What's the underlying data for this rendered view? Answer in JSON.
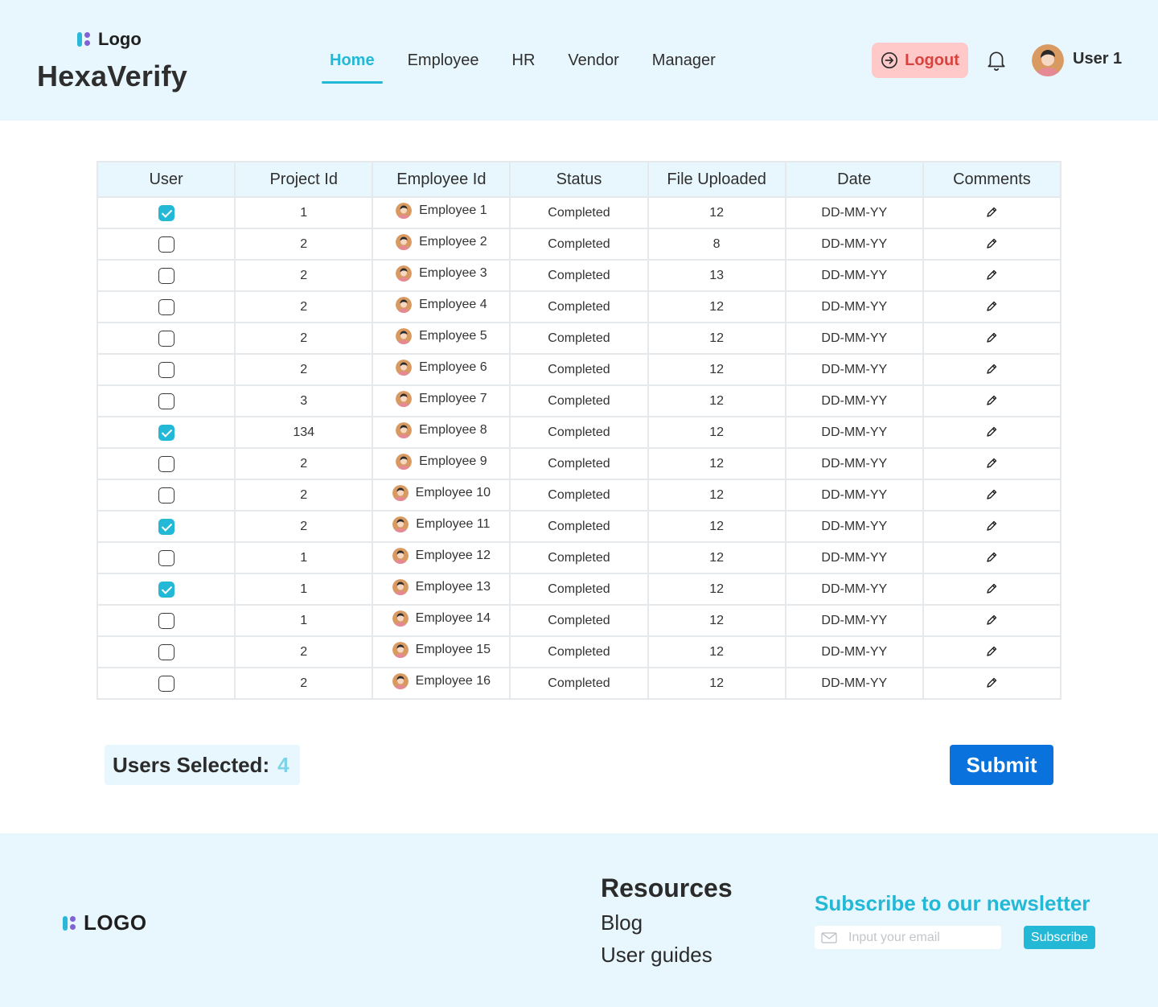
{
  "header": {
    "logo_text": "Logo",
    "app_title": "HexaVerify",
    "nav": [
      {
        "label": "Home",
        "active": true
      },
      {
        "label": "Employee",
        "active": false
      },
      {
        "label": "HR",
        "active": false
      },
      {
        "label": "Vendor",
        "active": false
      },
      {
        "label": "Manager",
        "active": false
      }
    ],
    "logout_label": "Logout",
    "user_name": "User 1"
  },
  "table": {
    "columns": [
      "User",
      "Project Id",
      "Employee Id",
      "Status",
      "File Uploaded",
      "Date",
      "Comments"
    ],
    "rows": [
      {
        "checked": true,
        "project_id": "1",
        "employee": "Employee 1",
        "status": "Completed",
        "files": "12",
        "date": "DD-MM-YY"
      },
      {
        "checked": false,
        "project_id": "2",
        "employee": "Employee 2",
        "status": "Completed",
        "files": "8",
        "date": "DD-MM-YY"
      },
      {
        "checked": false,
        "project_id": "2",
        "employee": "Employee 3",
        "status": "Completed",
        "files": "13",
        "date": "DD-MM-YY"
      },
      {
        "checked": false,
        "project_id": "2",
        "employee": "Employee 4",
        "status": "Completed",
        "files": "12",
        "date": "DD-MM-YY"
      },
      {
        "checked": false,
        "project_id": "2",
        "employee": "Employee 5",
        "status": "Completed",
        "files": "12",
        "date": "DD-MM-YY"
      },
      {
        "checked": false,
        "project_id": "2",
        "employee": "Employee 6",
        "status": "Completed",
        "files": "12",
        "date": "DD-MM-YY"
      },
      {
        "checked": false,
        "project_id": "3",
        "employee": "Employee 7",
        "status": "Completed",
        "files": "12",
        "date": "DD-MM-YY"
      },
      {
        "checked": true,
        "project_id": "134",
        "employee": "Employee 8",
        "status": "Completed",
        "files": "12",
        "date": "DD-MM-YY"
      },
      {
        "checked": false,
        "project_id": "2",
        "employee": "Employee 9",
        "status": "Completed",
        "files": "12",
        "date": "DD-MM-YY"
      },
      {
        "checked": false,
        "project_id": "2",
        "employee": "Employee 10",
        "status": "Completed",
        "files": "12",
        "date": "DD-MM-YY"
      },
      {
        "checked": true,
        "project_id": "2",
        "employee": "Employee 11",
        "status": "Completed",
        "files": "12",
        "date": "DD-MM-YY"
      },
      {
        "checked": false,
        "project_id": "1",
        "employee": "Employee 12",
        "status": "Completed",
        "files": "12",
        "date": "DD-MM-YY"
      },
      {
        "checked": true,
        "project_id": "1",
        "employee": "Employee 13",
        "status": "Completed",
        "files": "12",
        "date": "DD-MM-YY"
      },
      {
        "checked": false,
        "project_id": "1",
        "employee": "Employee 14",
        "status": "Completed",
        "files": "12",
        "date": "DD-MM-YY"
      },
      {
        "checked": false,
        "project_id": "2",
        "employee": "Employee 15",
        "status": "Completed",
        "files": "12",
        "date": "DD-MM-YY"
      },
      {
        "checked": false,
        "project_id": "2",
        "employee": "Employee 16",
        "status": "Completed",
        "files": "12",
        "date": "DD-MM-YY"
      }
    ]
  },
  "selection": {
    "label": "Users Selected:",
    "count": "4"
  },
  "submit_label": "Submit",
  "footer": {
    "logo_text": "LOGO",
    "resources_title": "Resources",
    "links": [
      "Blog",
      "User guides"
    ],
    "newsletter_title": "Subscribe to our newsletter",
    "email_placeholder": "Input your email",
    "subscribe_label": "Subscribe"
  },
  "colors": {
    "accent": "#22b8d6",
    "header_bg": "#e8f6fd",
    "submit_bg": "#0a72dc",
    "logout_bg": "#ffc9c9",
    "logout_text": "#d8433f"
  }
}
